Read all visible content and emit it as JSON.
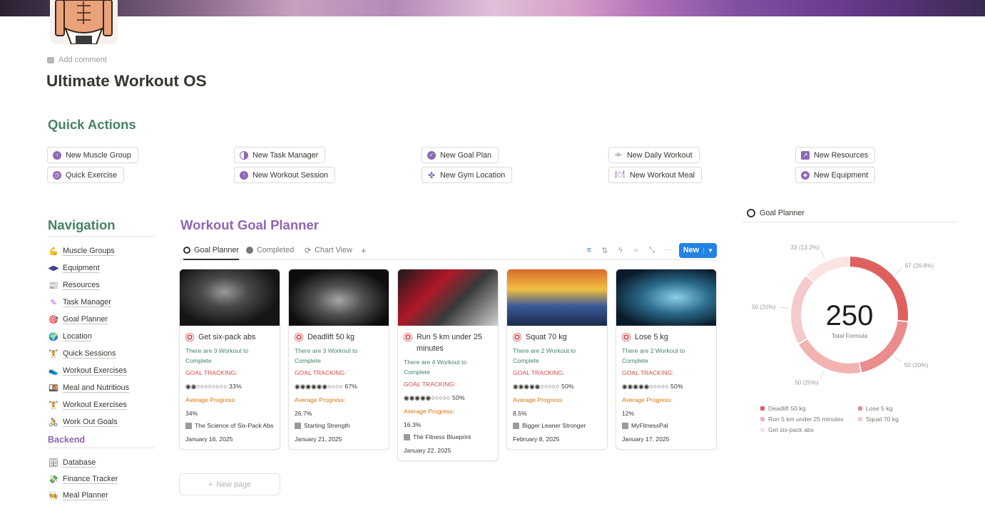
{
  "page": {
    "add_comment": "Add comment",
    "title": "Ultimate Workout OS"
  },
  "quick_actions": {
    "heading": "Quick Actions",
    "buttons": [
      {
        "label": "New Muscle Group",
        "icon": "arrow-up-circle-icon"
      },
      {
        "label": "Quick Exercise",
        "icon": "clock-icon"
      },
      {
        "label": "New Task Manager",
        "icon": "half-circle-icon"
      },
      {
        "label": "New Workout Session",
        "icon": "arrow-up-circle-icon"
      },
      {
        "label": "New Goal Plan",
        "icon": "check-badge-icon"
      },
      {
        "label": "New Gym Location",
        "icon": "clover-icon"
      },
      {
        "label": "New Daily Workout",
        "icon": "dumbbell-icon"
      },
      {
        "label": "New Workout Meal",
        "icon": "fork-plate-icon"
      },
      {
        "label": "New Resources",
        "icon": "arrow-square-icon"
      },
      {
        "label": "New Equipment",
        "icon": "compass-icon"
      }
    ]
  },
  "navigation": {
    "heading": "Navigation",
    "items": [
      {
        "label": "Muscle Groups",
        "icon": "muscle-icon"
      },
      {
        "label": "Equipment",
        "icon": "dumbbell-icon"
      },
      {
        "label": "Resources",
        "icon": "newspaper-icon"
      },
      {
        "label": "Task Manager",
        "icon": "pen-icon"
      },
      {
        "label": "Goal Planner",
        "icon": "target-icon"
      },
      {
        "label": "Location",
        "icon": "globe-icon"
      },
      {
        "label": "Quick Sessions",
        "icon": "weightlifter-icon"
      },
      {
        "label": "Workout Exercises",
        "icon": "shoe-icon"
      },
      {
        "label": "Meal and Nutritious",
        "icon": "meal-icon"
      },
      {
        "label": "Workout Exercises",
        "icon": "gym-icon"
      },
      {
        "label": "Work Out Goals",
        "icon": "bike-icon"
      }
    ],
    "backend_heading": "Backend",
    "backend_items": [
      {
        "label": "Database",
        "icon": "database-icon"
      },
      {
        "label": "Finance Tracker",
        "icon": "money-icon"
      },
      {
        "label": "Meal Planner",
        "icon": "chef-icon"
      }
    ]
  },
  "planner": {
    "heading": "Workout Goal Planner",
    "tabs": [
      {
        "label": "Goal Planner",
        "icon": "target-icon"
      },
      {
        "label": "Completed",
        "icon": "check-circle-icon"
      },
      {
        "label": "Chart View",
        "icon": "refresh-icon"
      }
    ],
    "add_tab": "+",
    "new_button": "New",
    "goal_tracking_label": "GOAL TRACKING:",
    "avg_progress_label": "Average Progress:",
    "new_page": "New page",
    "cards": [
      {
        "title": "Get six-pack abs",
        "workouts": "There are 3 Workout to Complete",
        "progress": "◉◉○○○○○○○○ 33%",
        "avg": "34%",
        "resource": "The Science of Six-Pack Abs",
        "date": "January 16, 2025"
      },
      {
        "title": "Deadlift 50 kg",
        "workouts": "There are 3 Workout to Complete",
        "progress": "◉◉◉◉◉◉○○○○ 67%",
        "avg": "26.7%",
        "resource": "Starting Strength",
        "date": "January 21, 2025"
      },
      {
        "title": "Run 5 km under 25 minutes",
        "workouts": "There are 4 Workout to Complete",
        "progress": "◉◉◉◉◉○○○○○ 50%",
        "avg": "16.3%",
        "resource": "The Fitness Blueprint",
        "date": "January 22, 2025"
      },
      {
        "title": "Squat 70 kg",
        "workouts": "There are 2 Workout to Complete",
        "progress": "◉◉◉◉◉○○○○○ 50%",
        "avg": "8.5%",
        "resource": "Bigger Leaner Stronger",
        "date": "February 8, 2025"
      },
      {
        "title": "Lose 5 kg",
        "workouts": "There are 2 Workout to Complete",
        "progress": "◉◉◉◉◉○○○○○ 50%",
        "avg": "12%",
        "resource": "MyFitnessPal",
        "date": "January 17, 2025"
      }
    ]
  },
  "chart_panel": {
    "heading": "Goal Planner",
    "total": "250",
    "total_label": "Total Formula"
  },
  "chart_data": {
    "type": "pie",
    "title": "",
    "categories": [
      "Deadlift 50 kg",
      "Lose 5 kg",
      "Squat 70 kg",
      "Run 5 km under 25 minutes",
      "Get six-pack abs"
    ],
    "values": [
      67,
      50,
      50,
      50,
      33
    ],
    "slice_labels": [
      "67 (26.8%)",
      "50 (20%)",
      "50 (20%)",
      "50 (20%)",
      "33 (13.2%)"
    ],
    "colors": [
      "#e06060",
      "#ea8c8c",
      "#f2b3b3",
      "#f6caca",
      "#fbe3e3"
    ],
    "legend": [
      {
        "label": "Deadlift 50 kg",
        "color": "#e06060"
      },
      {
        "label": "Lose 5 kg",
        "color": "#ea8c8c"
      },
      {
        "label": "Run 5 km under 25 minutes",
        "color": "#f2b3b3"
      },
      {
        "label": "Squat 70 kg",
        "color": "#f6caca"
      },
      {
        "label": "Get six-pack abs",
        "color": "#fbe3e3"
      }
    ]
  }
}
